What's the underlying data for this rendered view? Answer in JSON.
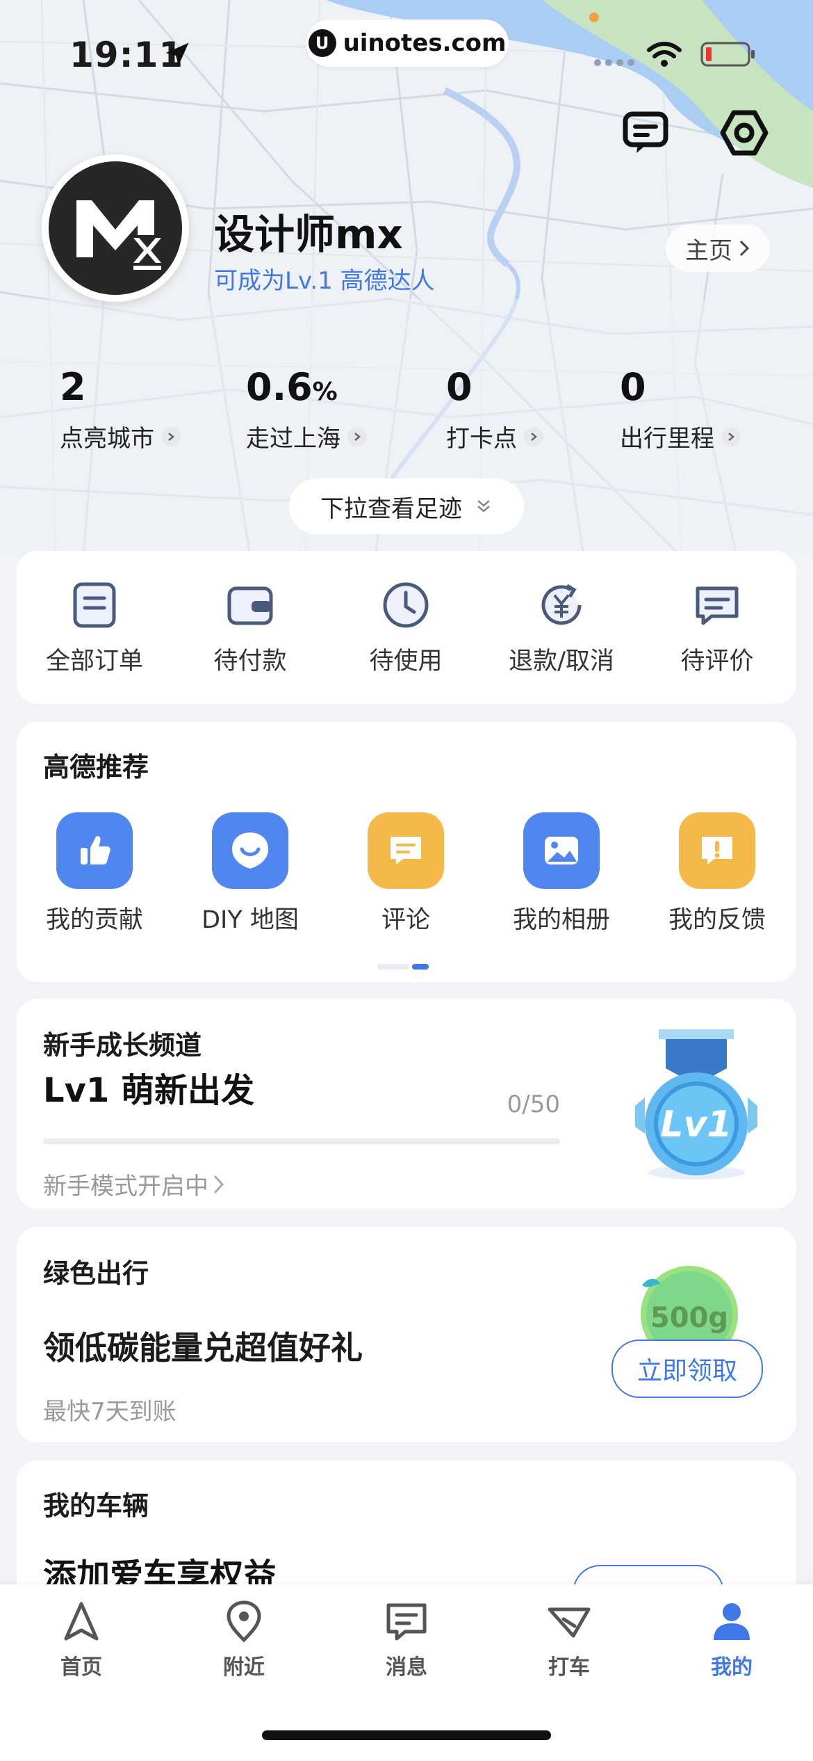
{
  "status_bar": {
    "time": "19:11",
    "watermark": "uinotes.com"
  },
  "header": {
    "message_icon": "message-icon",
    "settings_icon": "hexagon-settings-icon",
    "avatar_text": "Mx",
    "username": "设计师mx",
    "level_hint": "可成为Lv.1 高德达人",
    "home_button": "主页"
  },
  "stats": [
    {
      "value": "2",
      "unit": "",
      "label": "点亮城市"
    },
    {
      "value": "0.6",
      "unit": "%",
      "label": "走过上海"
    },
    {
      "value": "0",
      "unit": "",
      "label": "打卡点"
    },
    {
      "value": "0",
      "unit": "",
      "label": "出行里程"
    }
  ],
  "pull_hint": "下拉查看足迹",
  "orders": [
    {
      "label": "全部订单",
      "icon": "document-icon"
    },
    {
      "label": "待付款",
      "icon": "wallet-icon"
    },
    {
      "label": "待使用",
      "icon": "clock-icon"
    },
    {
      "label": "退款/取消",
      "icon": "refund-icon"
    },
    {
      "label": "待评价",
      "icon": "review-icon"
    }
  ],
  "recommend": {
    "title": "高德推荐",
    "items": [
      {
        "label": "我的贡献",
        "icon": "thumbs-up-icon",
        "color": "#4f86ef"
      },
      {
        "label": "DIY 地图",
        "icon": "smile-pin-icon",
        "color": "#4f86ef"
      },
      {
        "label": "评论",
        "icon": "comment-icon",
        "color": "#f5b94a"
      },
      {
        "label": "我的相册",
        "icon": "photo-icon",
        "color": "#4f86ef"
      },
      {
        "label": "我的反馈",
        "icon": "feedback-icon",
        "color": "#f5b94a"
      }
    ]
  },
  "growth": {
    "title": "新手成长频道",
    "level_title": "Lv1 萌新出发",
    "progress_text": "0/50",
    "progress_fraction": 0,
    "subtitle": "新手模式开启中",
    "medal_text": "Lv1"
  },
  "green": {
    "title": "绿色出行",
    "headline": "领低碳能量兑超值好礼",
    "subtitle": "最快7天到账",
    "badge_text": "500g",
    "button": "立即领取"
  },
  "vehicle": {
    "title": "我的车辆",
    "headline": "添加爱车享权益"
  },
  "tabbar": [
    {
      "label": "首页",
      "icon": "navigation-arrow-icon",
      "active": false
    },
    {
      "label": "附近",
      "icon": "location-pin-icon",
      "active": false
    },
    {
      "label": "消息",
      "icon": "message-icon",
      "active": false
    },
    {
      "label": "打车",
      "icon": "taxi-flag-icon",
      "active": false
    },
    {
      "label": "我的",
      "icon": "person-icon",
      "active": true
    }
  ],
  "colors": {
    "accent": "#3f78e8",
    "orange": "#f5b94a",
    "background": "#f2f3f6"
  }
}
